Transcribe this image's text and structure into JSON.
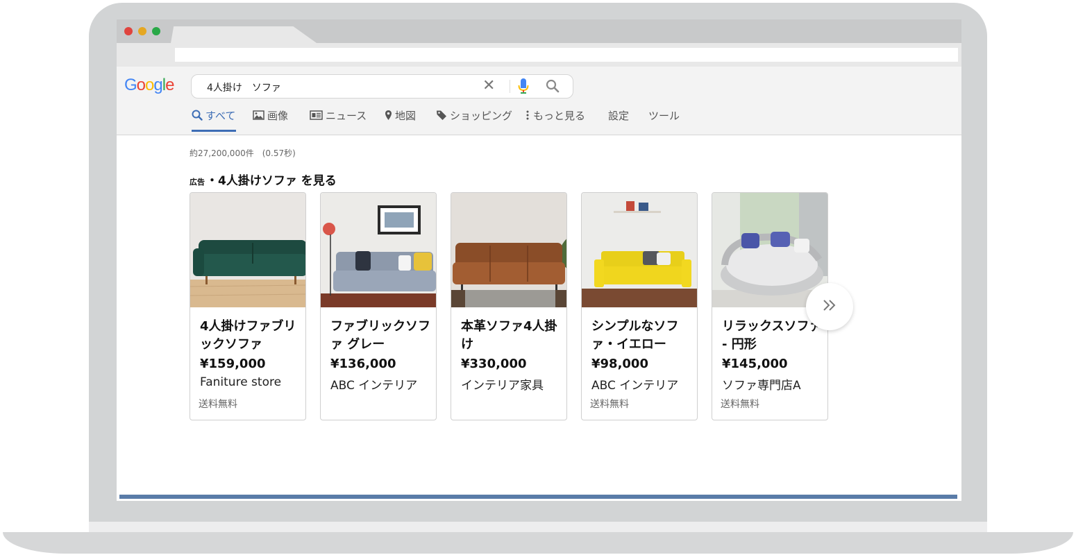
{
  "search": {
    "query": "4人掛け　ソファ"
  },
  "logo": {
    "letters": [
      "G",
      "o",
      "o",
      "g",
      "l",
      "e"
    ],
    "colors": [
      "#4285F4",
      "#EA4335",
      "#FBBC05",
      "#4285F4",
      "#34A853",
      "#EA4335"
    ]
  },
  "nav": {
    "items": [
      {
        "label": "すべて",
        "icon": "search-icon",
        "active": true
      },
      {
        "label": "画像",
        "icon": "image-icon"
      },
      {
        "label": "ニュース",
        "icon": "news-icon"
      },
      {
        "label": "地図",
        "icon": "map-pin-icon"
      },
      {
        "label": "ショッピング",
        "icon": "tag-icon"
      },
      {
        "label": "もっと見る",
        "icon": "more-vertical-icon"
      },
      {
        "label": "設定"
      },
      {
        "label": "ツール"
      }
    ]
  },
  "results": {
    "stats": "約27,200,000件　(0.57秒)",
    "ad_prefix": "広告",
    "ad_title": "・4人掛けソファ を見る"
  },
  "products": [
    {
      "title": "4人掛けファブリックソファ",
      "price": "¥159,000",
      "seller": "Faniture store",
      "shipping": "送料無料",
      "image": "green-sofa-image"
    },
    {
      "title": "ファブリックソファ グレー",
      "price": "¥136,000",
      "seller": "ABC インテリア",
      "shipping": "",
      "image": "grey-sofa-image"
    },
    {
      "title": "本革ソファ4人掛け",
      "price": "¥330,000",
      "seller": "インテリア家具",
      "shipping": "",
      "image": "leather-sofa-image"
    },
    {
      "title": "シンプルなソファ・イエロー",
      "price": "¥98,000",
      "seller": "ABC インテリア",
      "shipping": "送料無料",
      "image": "yellow-sofa-image"
    },
    {
      "title": "リラックスソファ - 円形",
      "price": "¥145,000",
      "seller": "ソファ専門店A",
      "shipping": "送料無料",
      "image": "round-sofa-image"
    }
  ],
  "colors": {
    "accent": "#3d6db5",
    "bottom_bar": "#5a7ca8"
  }
}
